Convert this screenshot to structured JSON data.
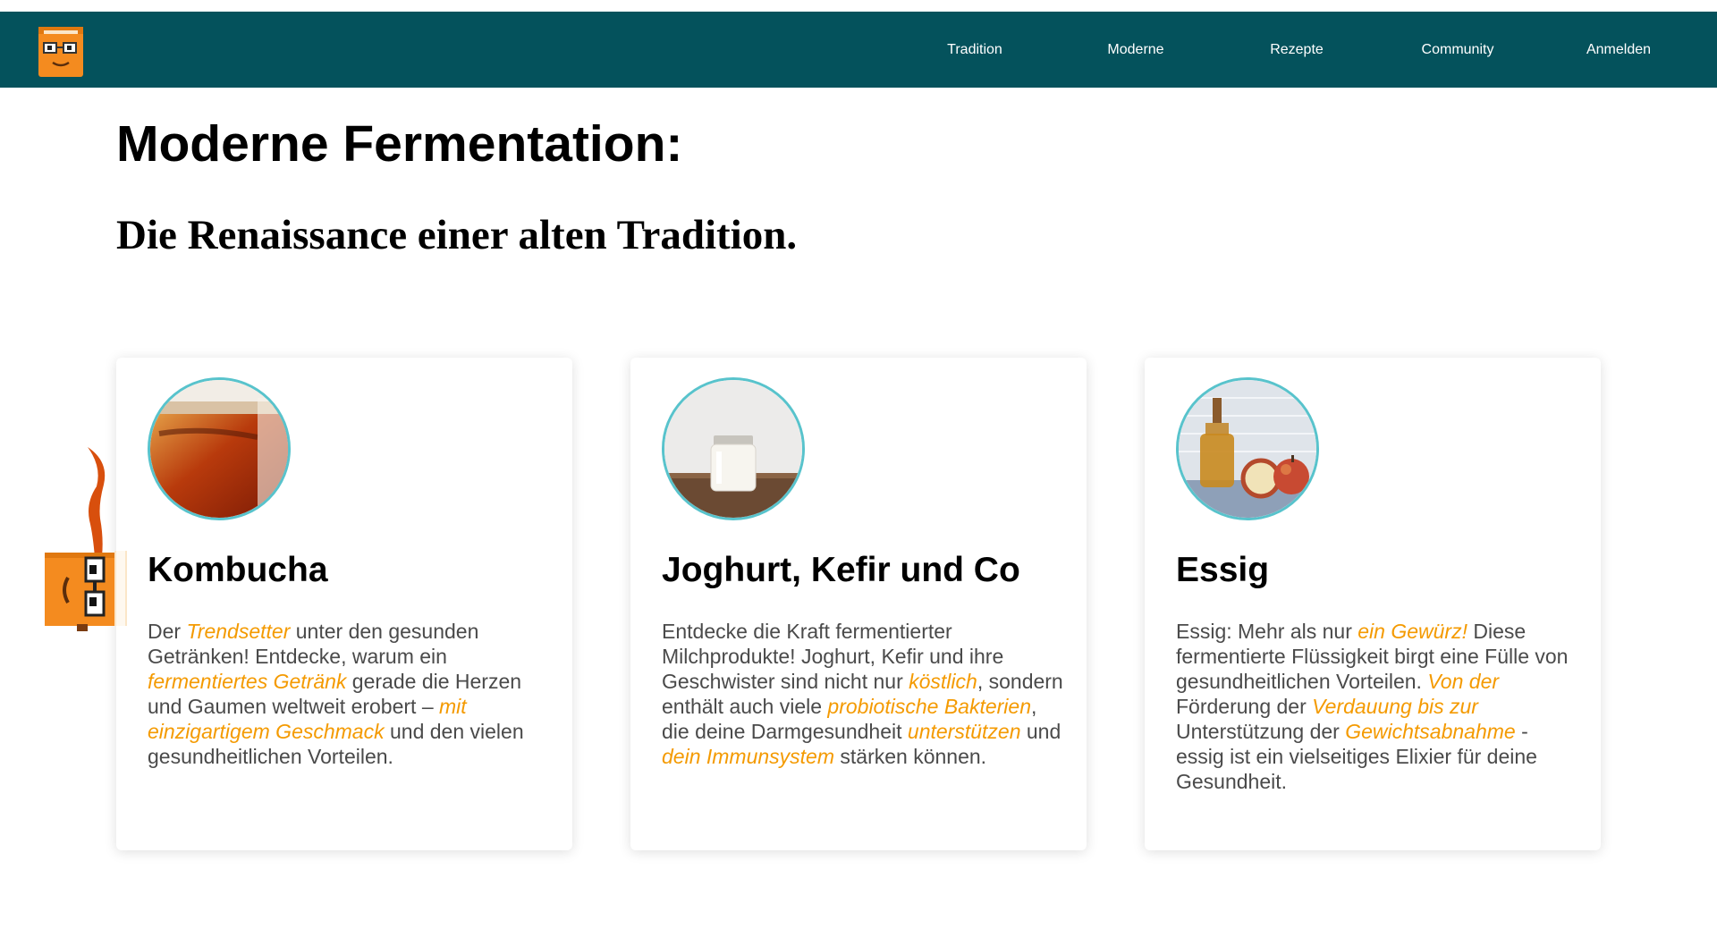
{
  "nav": {
    "items": [
      "Tradition",
      "Moderne",
      "Rezepte",
      "Community",
      "Anmelden"
    ]
  },
  "hero": {
    "title": "Moderne Fermentation:",
    "subtitle": "Die Renaissance einer alten Tradition."
  },
  "cards": [
    {
      "title": "Kombucha",
      "segments": [
        {
          "t": "Der "
        },
        {
          "t": "Trendsetter",
          "h": true
        },
        {
          "t": " unter den gesunden Getränken! Entdecke, warum ein "
        },
        {
          "t": "fermentiertes Getränk",
          "h": true
        },
        {
          "t": " gerade die Herzen und Gaumen weltweit erobert – "
        },
        {
          "t": "mit einzigartigem Geschmack",
          "h": true
        },
        {
          "t": " und den vielen gesundheitlichen Vorteilen."
        }
      ]
    },
    {
      "title": "Joghurt, Kefir und Co",
      "segments": [
        {
          "t": "Entdecke die Kraft fermentierter Milchprodukte! Joghurt, Kefir und ihre Geschwister sind nicht nur "
        },
        {
          "t": "köstlich",
          "h": true
        },
        {
          "t": ", sondern enthält auch viele "
        },
        {
          "t": "probiotische Bakterien",
          "h": true
        },
        {
          "t": ", die deine Darmgesundheit "
        },
        {
          "t": "unterstützen",
          "h": true
        },
        {
          "t": " und "
        },
        {
          "t": "dein Immunsystem",
          "h": true
        },
        {
          "t": " stärken können."
        }
      ]
    },
    {
      "title": "Essig",
      "segments": [
        {
          "t": "Essig: Mehr als nur "
        },
        {
          "t": "ein Gewürz!",
          "h": true
        },
        {
          "t": " Diese fermentierte Flüssigkeit birgt eine Fülle von gesundheitlichen Vorteilen. "
        },
        {
          "t": "Von der",
          "h": true
        },
        {
          "t": " Förderung der "
        },
        {
          "t": "Verdauung bis zur",
          "h": true
        },
        {
          "t": " Unterstützung der "
        },
        {
          "t": "Gewichtsabnahme",
          "h": true
        },
        {
          "t": " - essig ist ein vielseitiges Elixier für deine Gesundheit."
        }
      ]
    }
  ],
  "colors": {
    "navbar": "#04525c",
    "highlight": "#f49a00",
    "ring": "#58c3cc",
    "mascot": "#f48b1f"
  },
  "icons": [
    "logo-icon",
    "kombucha-photo",
    "yogurt-jar-photo",
    "vinegar-apples-photo",
    "mascot-icon"
  ]
}
